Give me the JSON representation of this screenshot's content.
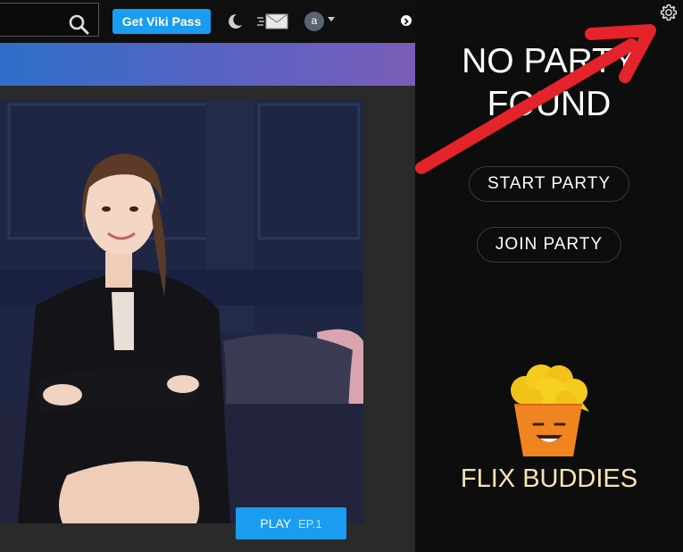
{
  "header": {
    "cta_label": "Get Viki Pass",
    "avatar_letter": "a"
  },
  "hero": {
    "play_label": "PLAY",
    "episode_label": "EP.1"
  },
  "panel": {
    "title": "NO PARTY FOUND",
    "start_label": "START PARTY",
    "join_label": "JOIN PARTY",
    "brand_name": "FLIX BUDDIES"
  },
  "icons": [
    "search-icon",
    "moon-icon",
    "mail-icon",
    "chevron-right-icon",
    "gear-icon",
    "popcorn-logo"
  ],
  "colors": {
    "accent_blue": "#1a9cf0",
    "annotation_red": "#e5232a",
    "brand_cream": "#f7e4b4"
  }
}
